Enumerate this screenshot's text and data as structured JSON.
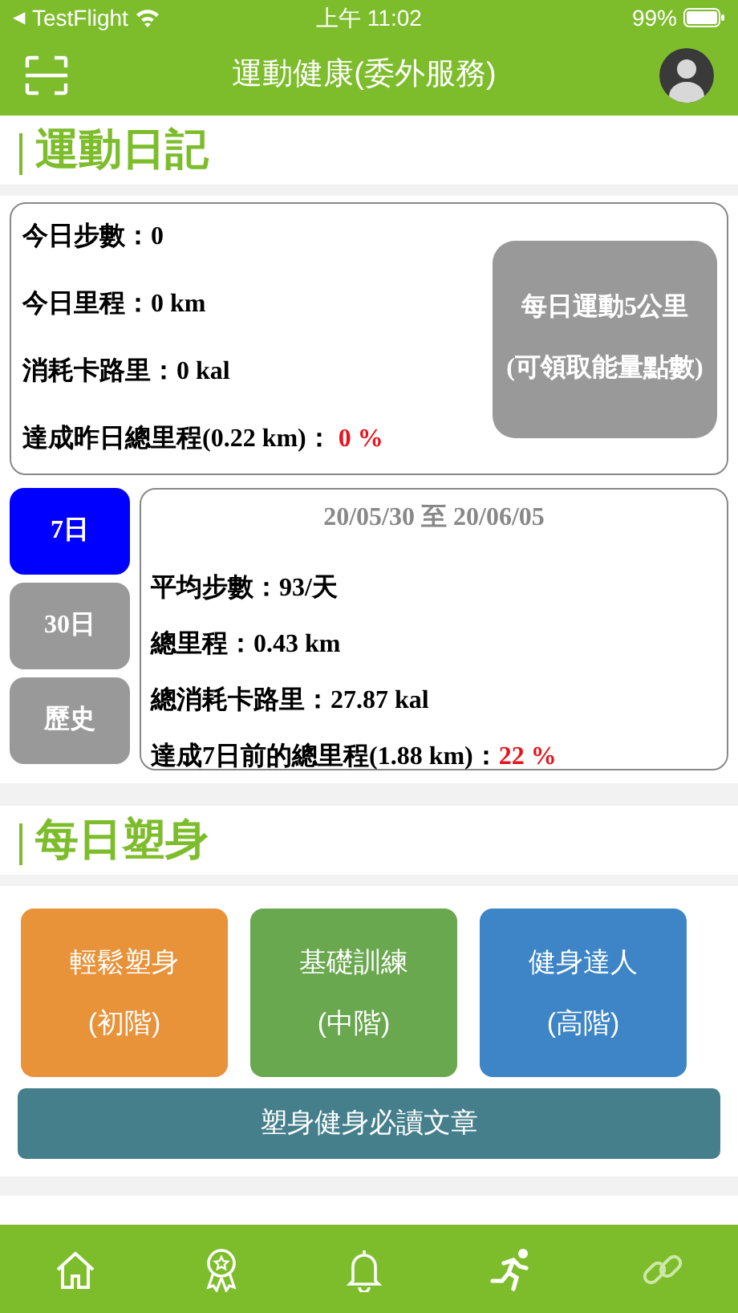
{
  "status_bar": {
    "back_arrow": "◀",
    "back_app": "TestFlight",
    "time": "上午 11:02",
    "battery": "99%"
  },
  "header": {
    "title": "運動健康(委外服務)"
  },
  "diary": {
    "title": "運動日記",
    "today": [
      {
        "label": "今日步數：",
        "value": "0",
        "highlight": false
      },
      {
        "label": "今日里程：",
        "value": "0 km",
        "highlight": false
      },
      {
        "label": "消耗卡路里：",
        "value": "0 kal",
        "highlight": false
      },
      {
        "label": "達成昨日總里程(0.22 km)：",
        "value": " 0 %",
        "highlight": true
      }
    ],
    "goal_button": {
      "lines": [
        "每日運動5公里",
        "(可領取能量點數)"
      ]
    },
    "periods": [
      {
        "label": "7日",
        "selected": true
      },
      {
        "label": "30日",
        "selected": false
      },
      {
        "label": "歷史",
        "selected": false
      }
    ],
    "range": "20/05/30 至 20/06/05",
    "summary": [
      {
        "label": "平均步數：",
        "value": "93/天",
        "highlight": false
      },
      {
        "label": "總里程：",
        "value": "0.43 km",
        "highlight": false
      },
      {
        "label": "總消耗卡路里：",
        "value": "27.87 kal",
        "highlight": false
      },
      {
        "label": "達成7日前的總里程(1.88 km)：",
        "value": "22 %",
        "highlight": true
      }
    ]
  },
  "shaping": {
    "title": "每日塑身",
    "programs": [
      {
        "name": "輕鬆塑身",
        "level": "(初階)",
        "color": "#e8923a"
      },
      {
        "name": "基礎訓練",
        "level": "(中階)",
        "color": "#69a84f"
      },
      {
        "name": "健身達人",
        "level": "(高階)",
        "color": "#3d85c6"
      }
    ],
    "article_button": "塑身健身必讀文章"
  }
}
